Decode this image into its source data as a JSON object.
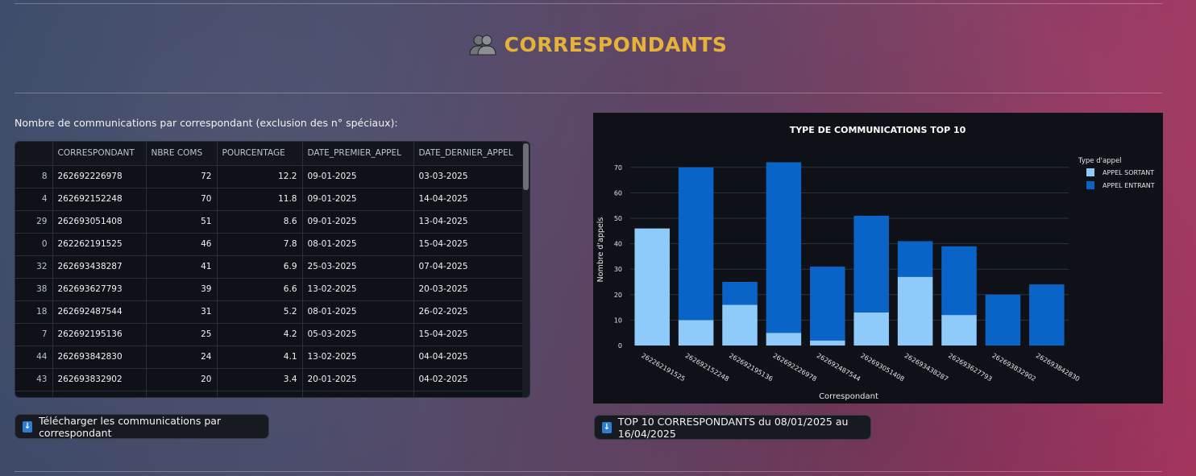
{
  "page": {
    "title": "CORRESPONDANTS",
    "title_icon": "two-people-icon",
    "accent_color": "#e6b33a"
  },
  "table_section": {
    "caption": "Nombre de communications par correspondant (exclusion des n° spéciaux):",
    "columns": [
      "",
      "CORRESPONDANT",
      "NBRE COMS",
      "POURCENTAGE",
      "DATE_PREMIER_APPEL",
      "DATE_DERNIER_APPEL"
    ],
    "rows": [
      [
        "8",
        "262692226978",
        "72",
        "12.2",
        "09-01-2025",
        "03-03-2025"
      ],
      [
        "4",
        "262692152248",
        "70",
        "11.8",
        "09-01-2025",
        "14-04-2025"
      ],
      [
        "29",
        "262693051408",
        "51",
        "8.6",
        "09-01-2025",
        "13-04-2025"
      ],
      [
        "0",
        "262262191525",
        "46",
        "7.8",
        "08-01-2025",
        "15-04-2025"
      ],
      [
        "32",
        "262693438287",
        "41",
        "6.9",
        "25-03-2025",
        "07-04-2025"
      ],
      [
        "38",
        "262693627793",
        "39",
        "6.6",
        "13-02-2025",
        "20-03-2025"
      ],
      [
        "18",
        "262692487544",
        "31",
        "5.2",
        "08-01-2025",
        "26-02-2025"
      ],
      [
        "7",
        "262692195136",
        "25",
        "4.2",
        "05-03-2025",
        "15-04-2025"
      ],
      [
        "44",
        "262693842830",
        "24",
        "4.1",
        "13-02-2025",
        "04-04-2025"
      ],
      [
        "43",
        "262693832902",
        "20",
        "3.4",
        "20-01-2025",
        "04-02-2025"
      ],
      [
        "",
        "",
        "",
        "",
        "",
        ""
      ]
    ],
    "download_button": {
      "icon": "download-icon",
      "label": "Télécharger les communications par correspondant"
    }
  },
  "chart_section": {
    "download_button": {
      "icon": "download-icon",
      "label": "TOP 10 CORRESPONDANTS du 08/01/2025 au 16/04/2025"
    }
  },
  "chart_data": {
    "type": "bar",
    "stacked": true,
    "title": "TYPE DE COMMUNICATIONS TOP 10",
    "xlabel": "Correspondant",
    "ylabel": "Nombre d'appels",
    "ylim": [
      0,
      75
    ],
    "yticks": [
      0,
      10,
      20,
      30,
      40,
      50,
      60,
      70
    ],
    "grid": true,
    "legend_title": "Type d'appel",
    "legend_position": "top-right",
    "categories": [
      "262262191525",
      "262692152248",
      "262692195136",
      "262692226978",
      "262692487544",
      "262693051408",
      "262693438287",
      "262693627793",
      "262693832902",
      "262693842830"
    ],
    "series": [
      {
        "name": "APPEL SORTANT",
        "color": "#8ecbfb",
        "values": [
          46,
          10,
          16,
          5,
          2,
          13,
          27,
          12,
          0,
          0
        ]
      },
      {
        "name": "APPEL ENTRANT",
        "color": "#0a63c6",
        "values": [
          0,
          60,
          9,
          67,
          29,
          38,
          14,
          27,
          20,
          24
        ]
      }
    ],
    "background": "#0e1117"
  }
}
